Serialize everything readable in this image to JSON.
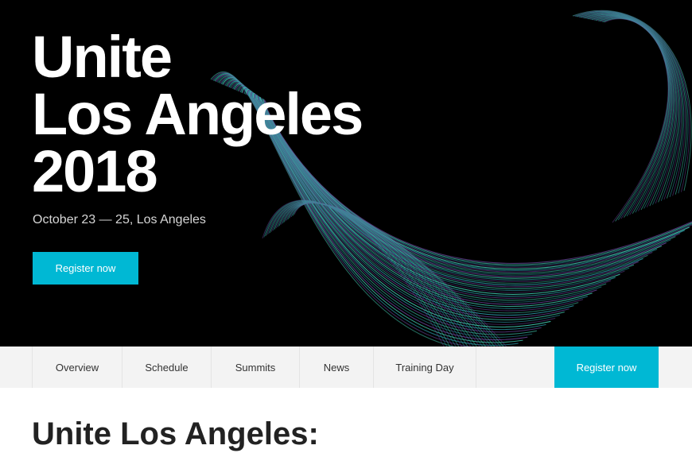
{
  "hero": {
    "title_lines": [
      "Unite",
      "Los Angeles",
      "2018"
    ],
    "subtitle": "October 23 — 25, Los Angeles",
    "register_label": "Register now",
    "art_colors": [
      "#3fbfa8",
      "#5f3d8a",
      "#2b8fa0"
    ]
  },
  "subnav": {
    "items": [
      {
        "label": "Overview"
      },
      {
        "label": "Schedule"
      },
      {
        "label": "Summits"
      },
      {
        "label": "News"
      },
      {
        "label": "Training Day"
      }
    ],
    "register_label": "Register now"
  },
  "content": {
    "heading": "Unite Los Angeles:"
  },
  "colors": {
    "accent": "#00b8d4",
    "hero_bg": "#000000",
    "nav_bg": "#f3f3f3"
  }
}
